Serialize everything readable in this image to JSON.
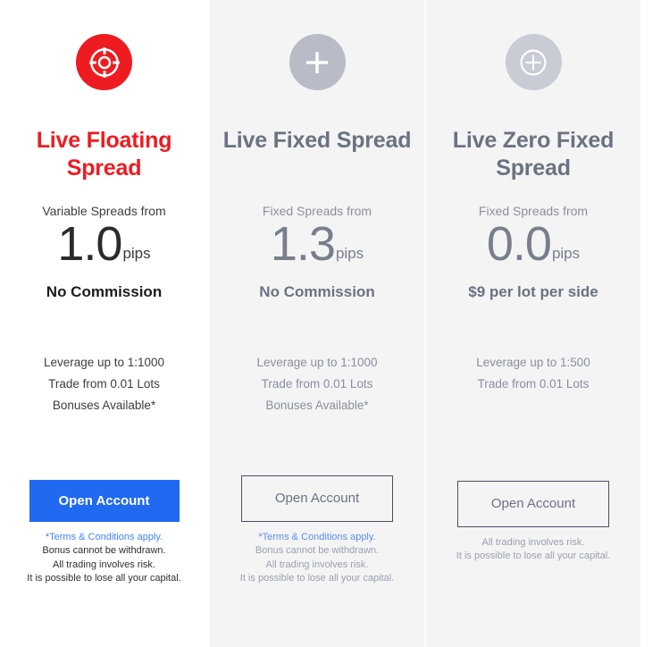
{
  "page": {
    "background": "#ffffff",
    "accent_red": "#ee1c21",
    "accent_blue": "#2069f0",
    "slate": "#6b7280"
  },
  "plans": [
    {
      "id": "live-floating-spread",
      "icon": "lifebuoy-icon",
      "icon_bg": "#ee1c21",
      "title": "Live Floating Spread",
      "title_color": "#ee1c21",
      "spread_label": "Variable Spreads from",
      "figure": "1.0",
      "unit": "pips",
      "commission": "No Commission",
      "features": [
        "Leverage up to 1:1000",
        "Trade from 0.01 Lots",
        "Bonuses Available*"
      ],
      "cta_label": "Open Account",
      "cta_style": "filled",
      "footnotes": [
        "*Terms & Conditions apply.",
        "Bonus cannot be withdrawn.",
        "All trading involves risk.",
        "It is possible to lose all your capital."
      ],
      "footnote_link_index": 0
    },
    {
      "id": "live-fixed-spread",
      "icon": "plus-icon",
      "icon_bg": "#b9bcc6",
      "title": "Live Fixed Spread",
      "title_color": "#6b7280",
      "spread_label": "Fixed Spreads from",
      "figure": "1.3",
      "unit": "pips",
      "commission": "No Commission",
      "features": [
        "Leverage up to 1:1000",
        "Trade from 0.01 Lots",
        "Bonuses Available*"
      ],
      "cta_label": "Open Account",
      "cta_style": "outline",
      "footnotes": [
        "*Terms & Conditions apply.",
        "Bonus cannot be withdrawn.",
        "All trading involves risk.",
        "It is possible to lose all your capital."
      ],
      "footnote_link_index": 0
    },
    {
      "id": "live-zero-fixed-spread",
      "icon": "circle-plus-icon",
      "icon_bg": "#c9ccd4",
      "title": "Live Zero Fixed Spread",
      "title_color": "#6b7280",
      "spread_label": "Fixed Spreads from",
      "figure": "0.0",
      "unit": "pips",
      "commission": "$9 per lot per side",
      "features": [
        "Leverage up to 1:500",
        "Trade from 0.01 Lots"
      ],
      "cta_label": "Open Account",
      "cta_style": "outline",
      "footnotes": [
        "All trading involves risk.",
        "It is possible to lose all your capital."
      ],
      "footnote_link_index": -1
    }
  ]
}
